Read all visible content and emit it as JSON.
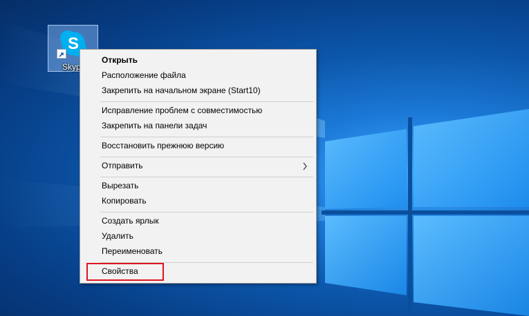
{
  "desktop": {
    "icon": {
      "label": "Skyp",
      "icon_name": "skype-icon",
      "overlay": "shortcut-arrow-icon"
    }
  },
  "context_menu": {
    "items": [
      {
        "label": "Открыть",
        "bold": true
      },
      {
        "label": "Расположение файла"
      },
      {
        "label": "Закрепить на начальном экране (Start10)"
      },
      {
        "label": "Исправление проблем с совместимостью"
      },
      {
        "label": "Закрепить на панели задач"
      },
      {
        "label": "Восстановить прежнюю версию"
      },
      {
        "label": "Отправить",
        "submenu": true
      },
      {
        "label": "Вырезать"
      },
      {
        "label": "Копировать"
      },
      {
        "label": "Создать ярлык"
      },
      {
        "label": "Удалить"
      },
      {
        "label": "Переименовать"
      },
      {
        "label": "Свойства",
        "highlighted": true
      }
    ]
  },
  "colors": {
    "highlight_border": "#e0131f",
    "skype_blue": "#00aff0",
    "menu_bg": "#f2f2f2"
  }
}
